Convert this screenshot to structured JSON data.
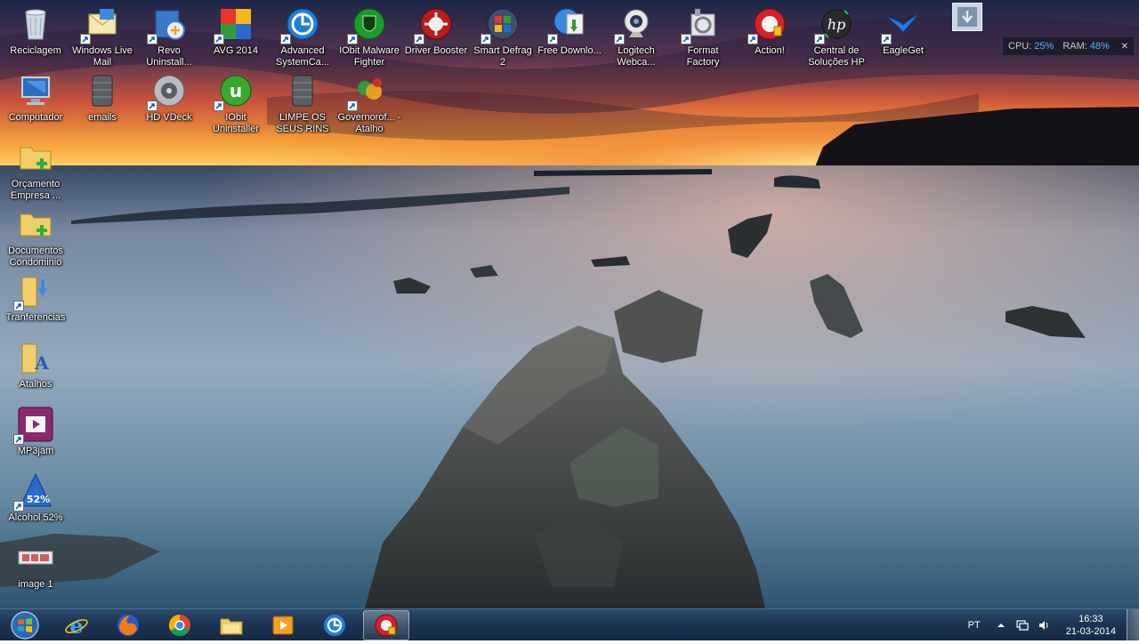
{
  "desktop": {
    "icons": [
      {
        "label": "Reciclagem",
        "icon": "recycle-bin-icon"
      },
      {
        "label": "Windows Live Mail",
        "icon": "windows-live-mail-icon"
      },
      {
        "label": "Revo Uninstall...",
        "icon": "revo-uninstaller-icon"
      },
      {
        "label": "AVG 2014",
        "icon": "avg-icon"
      },
      {
        "label": "Advanced SystemCa...",
        "icon": "advanced-systemcare-icon"
      },
      {
        "label": "IObit Malware Fighter",
        "icon": "iobit-malware-fighter-icon"
      },
      {
        "label": "Driver Booster",
        "icon": "driver-booster-icon"
      },
      {
        "label": "Smart Defrag 2",
        "icon": "smart-defrag-icon"
      },
      {
        "label": "Free Downlo...",
        "icon": "free-download-manager-icon"
      },
      {
        "label": "Logitech Webca...",
        "icon": "logitech-webcam-icon"
      },
      {
        "label": "Format Factory",
        "icon": "format-factory-icon"
      },
      {
        "label": "Action!",
        "icon": "action-recorder-icon"
      },
      {
        "label": "Central de Soluções HP",
        "icon": "hp-icon"
      },
      {
        "label": "EagleGet",
        "icon": "eagleget-icon"
      },
      {
        "label": "Computador",
        "icon": "computer-icon"
      },
      {
        "label": "emails",
        "icon": "archive-icon"
      },
      {
        "label": "HD VDeck",
        "icon": "hd-vdeck-icon"
      },
      {
        "label": "IObit Uninstaller",
        "icon": "iobit-uninstaller-icon"
      },
      {
        "label": "LIMPE OS SEUS RINS",
        "icon": "archive-icon"
      },
      {
        "label": "Governorof... - Atalho",
        "icon": "game-icon"
      },
      {
        "label": "Orçamento Empresa ...",
        "icon": "folder-add-icon"
      },
      {
        "label": "Documentos Condominio",
        "icon": "folder-add-icon"
      },
      {
        "label": "Tranferencias",
        "icon": "downloads-folder-icon"
      },
      {
        "label": "Atalhos",
        "icon": "shortcuts-folder-icon"
      },
      {
        "label": "MP3jam",
        "icon": "mp3jam-icon"
      },
      {
        "label": "Alcohol 52%",
        "icon": "alcohol-52-icon"
      },
      {
        "label": "image 1",
        "icon": "image-file-icon"
      }
    ]
  },
  "widget": {
    "cpu_label": "CPU:",
    "cpu_value": "25%",
    "ram_label": "RAM:",
    "ram_value": "48%",
    "close_icon": "close-icon"
  },
  "taskbar": {
    "pinned": [
      {
        "app": "Internet Explorer",
        "icon": "internet-explorer-icon"
      },
      {
        "app": "Firefox",
        "icon": "firefox-icon"
      },
      {
        "app": "Chrome",
        "icon": "chrome-icon"
      },
      {
        "app": "Windows Explorer",
        "icon": "explorer-folder-icon"
      },
      {
        "app": "Media Player",
        "icon": "media-player-icon"
      },
      {
        "app": "Advanced SystemCare",
        "icon": "advanced-systemcare-icon"
      },
      {
        "app": "Action!",
        "icon": "action-recorder-icon",
        "active": true
      }
    ],
    "language": "PT",
    "time": "16:33",
    "date": "21-03-2014"
  },
  "colors": {
    "taskbar": "#1d3553",
    "accent_blue": "#58b7ff"
  }
}
